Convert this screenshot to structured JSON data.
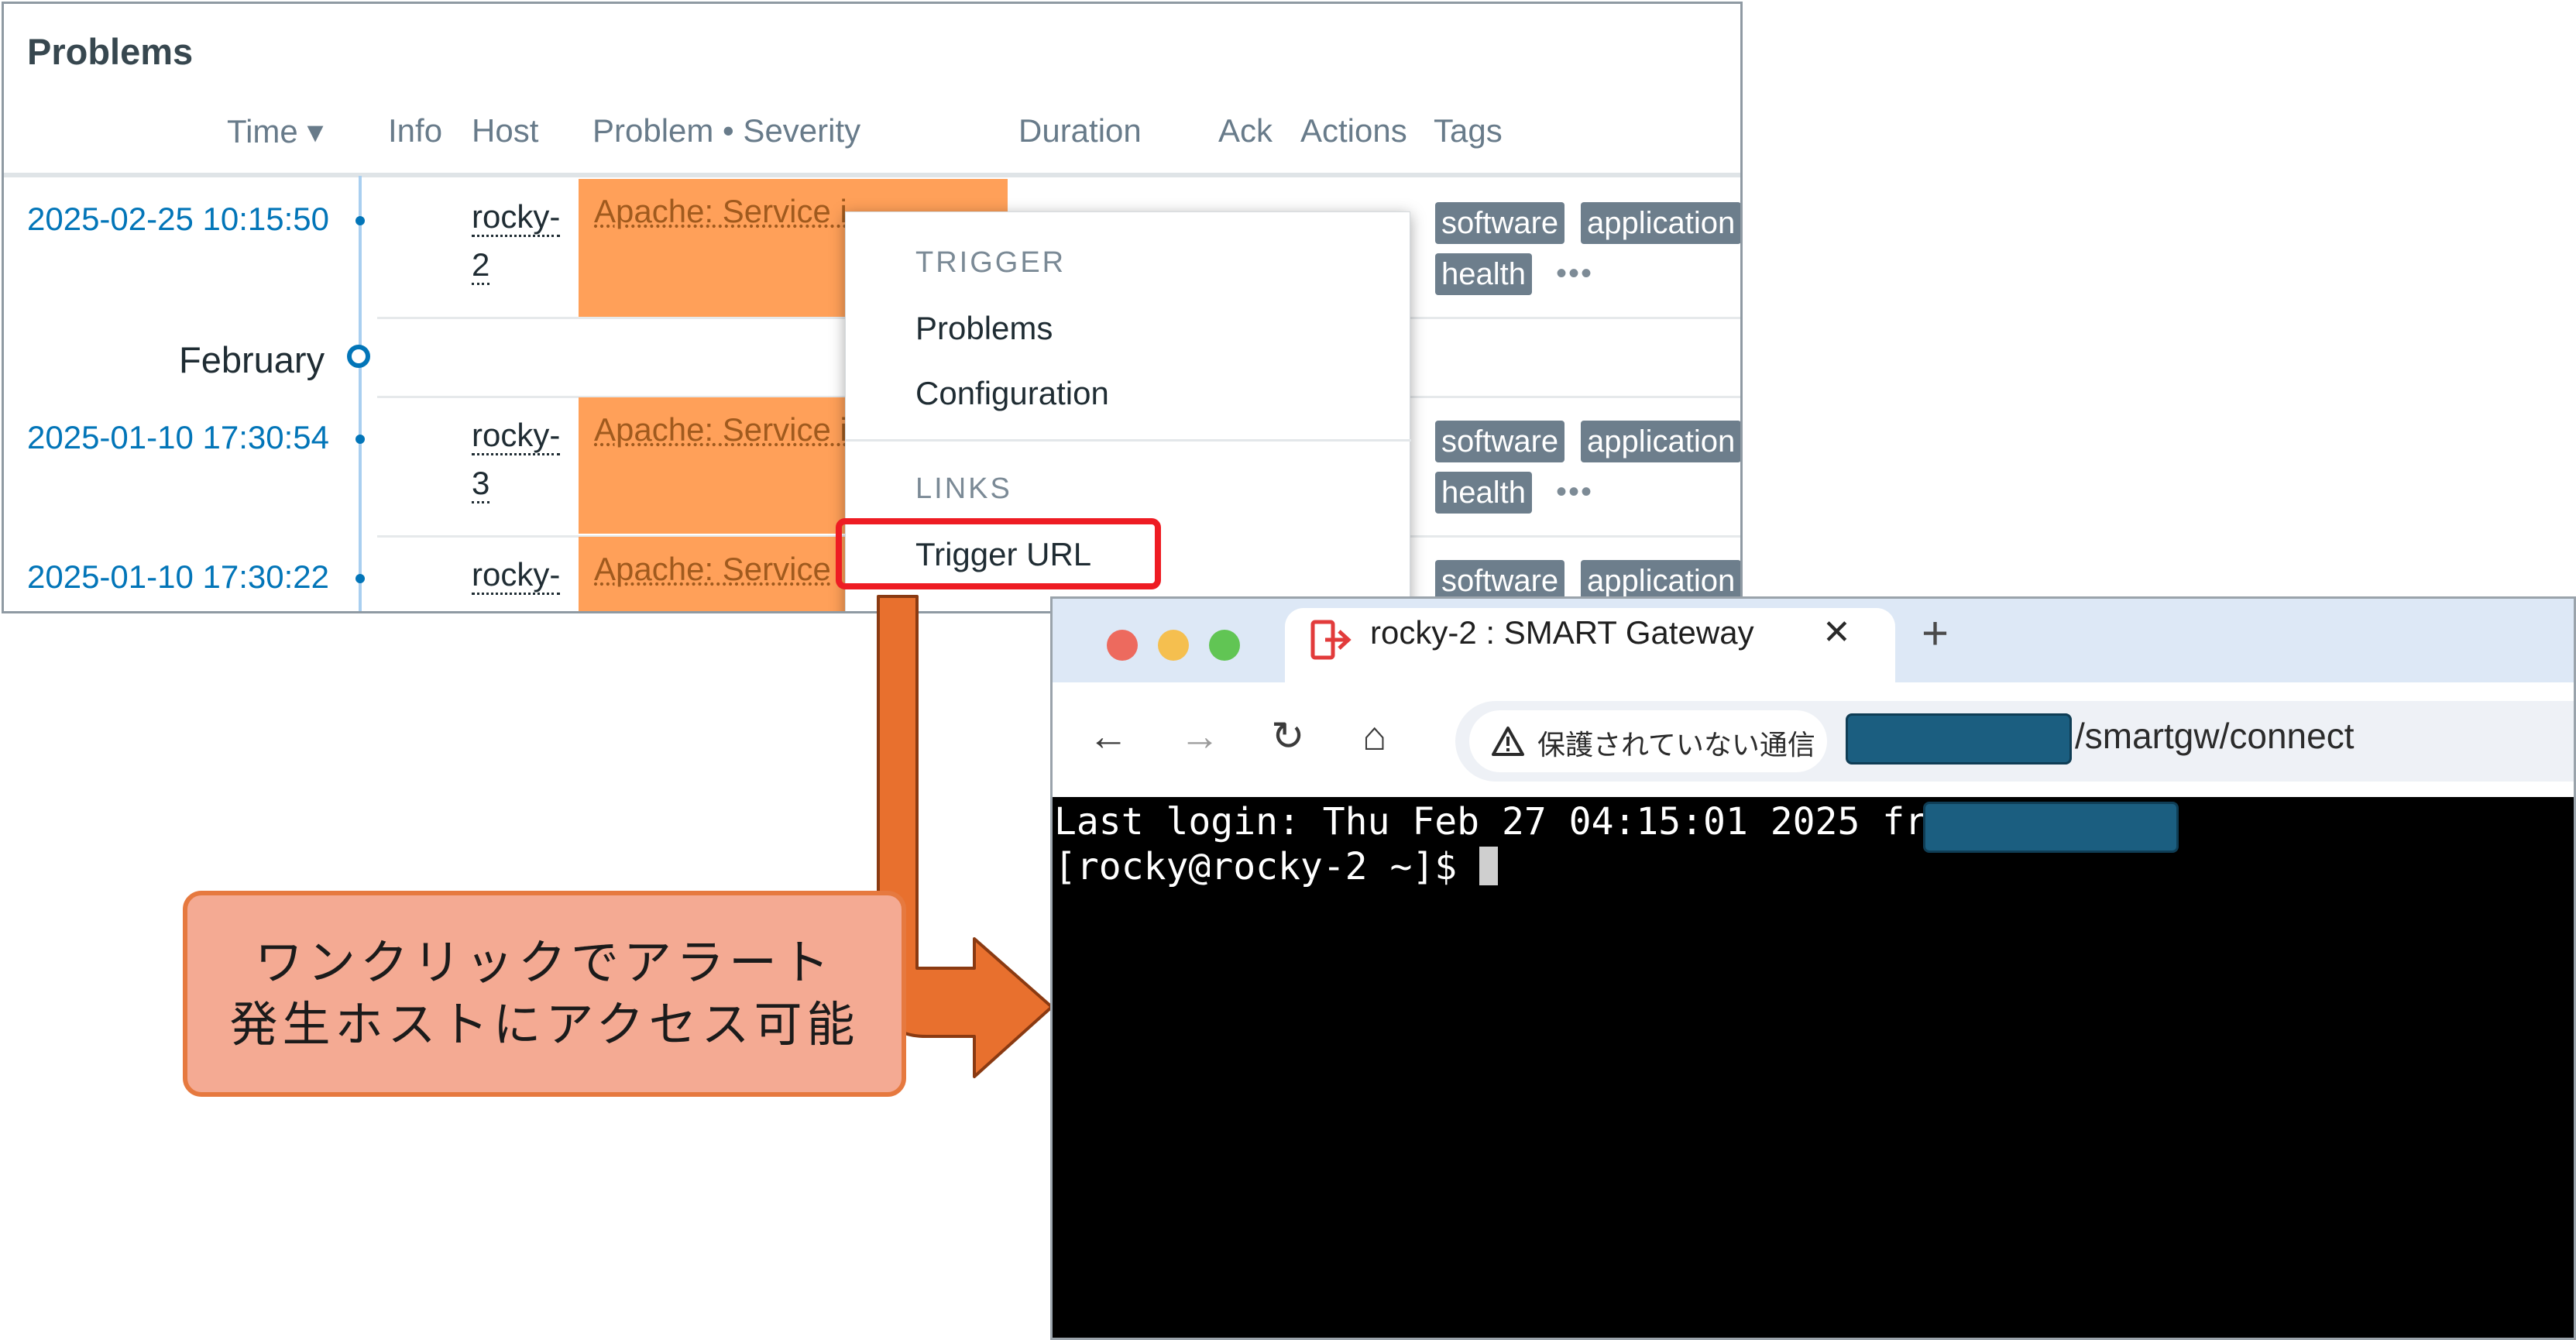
{
  "problems": {
    "title": "Problems",
    "columns": [
      "Time ▾",
      "Info",
      "Host",
      "Problem • Severity",
      "Duration",
      "Ack",
      "Actions",
      "Tags"
    ],
    "month_label": "February",
    "rows": [
      {
        "time": "2025-02-25 10:15:50",
        "host_a": "rocky-",
        "host_b": "2",
        "problem": "Apache: Service i",
        "tags": [
          "software",
          "application",
          "health"
        ],
        "more": "•••"
      },
      {
        "time": "2025-01-10 17:30:54",
        "host_a": "rocky-",
        "host_b": "3",
        "problem": "Apache: Service i",
        "tags": [
          "software",
          "application",
          "health"
        ],
        "more": "•••"
      },
      {
        "time": "2025-01-10 17:30:22",
        "host_a": "rocky-",
        "host_b": "",
        "problem": "Apache: Service",
        "tags": [
          "software",
          "application"
        ],
        "more": ""
      }
    ],
    "severity_color": "#ffa059"
  },
  "context_menu": {
    "trigger_heading": "TRIGGER",
    "trigger_items": [
      "Problems",
      "Configuration"
    ],
    "links_heading": "LINKS",
    "links_items": [
      "Trigger URL"
    ],
    "highlight_color": "#ee1c23"
  },
  "callout": {
    "line1": "ワンクリックでアラート",
    "line2": "発生ホストにアクセス可能",
    "fill": "#f4aa93",
    "border": "#e6793f"
  },
  "browser": {
    "tab_title": "rocky-2 : SMART Gateway",
    "tab_close": "✕",
    "new_tab": "+",
    "nav": {
      "back": "←",
      "forward": "→",
      "reload": "↻",
      "home": "⌂"
    },
    "security_chip": "保護されていない通信",
    "url_tail": "/smartgw/connect",
    "terminal": {
      "line1": "Last login: Thu Feb 27 04:15:01 2025 from",
      "line2": "[rocky@rocky-2 ~]$ "
    },
    "traffic_lights": [
      "#ed6a5e",
      "#f5bf4f",
      "#61c554"
    ],
    "redaction_color": "#1b5e80"
  }
}
